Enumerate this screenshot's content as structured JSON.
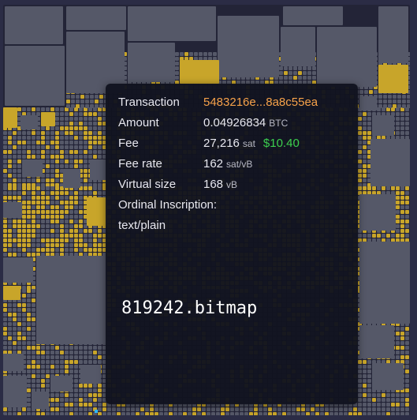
{
  "tooltip": {
    "transaction_label": "Transaction",
    "transaction_id": "5483216e...8a8c55ea",
    "amount_label": "Amount",
    "amount_value": "0.04926834",
    "amount_unit": "BTC",
    "fee_label": "Fee",
    "fee_value": "27,216",
    "fee_unit": "sat",
    "fee_fiat": "$10.40",
    "fee_rate_label": "Fee rate",
    "fee_rate_value": "162",
    "fee_rate_unit": "sat/vB",
    "vsize_label": "Virtual size",
    "vsize_value": "168",
    "vsize_unit": "vB",
    "inscription_label": "Ordinal Inscription:",
    "inscription_type": "text/plain",
    "inscription_content": "819242.bitmap"
  },
  "colors": {
    "background": "#2b2c45",
    "block_grey": "#555868",
    "block_yellow": "#c8a52a",
    "txid": "#f7a24a",
    "fiat": "#3ccf4e"
  }
}
